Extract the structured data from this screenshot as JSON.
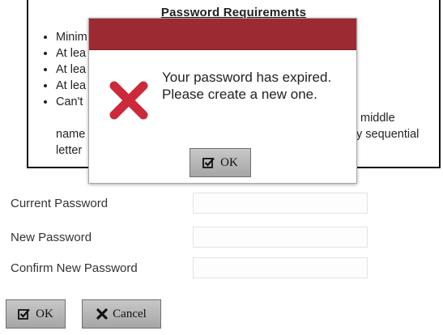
{
  "requirements": {
    "title": "Password Requirements",
    "items": [
      "Minim",
      "At lea",
      "At lea",
      "At lea",
      "Can't"
    ],
    "line2_left": "name",
    "line3_left": "letter",
    "right_middle": "middle",
    "right_sequential": "y sequential"
  },
  "dialog": {
    "message": "Your password has expired. Please create a new one.",
    "ok_label": "OK",
    "header_color": "#9c2a33",
    "icon": "error-x-icon",
    "icon_color": "#cc2a3a"
  },
  "form": {
    "current_label": "Current Password",
    "current_value": "",
    "new_label": "New Password",
    "new_value": "",
    "confirm_label": "Confirm New Password",
    "confirm_value": ""
  },
  "actions": {
    "ok_label": "OK",
    "cancel_label": "Cancel",
    "ok_icon": "checkbox-icon",
    "cancel_icon": "x-icon"
  }
}
